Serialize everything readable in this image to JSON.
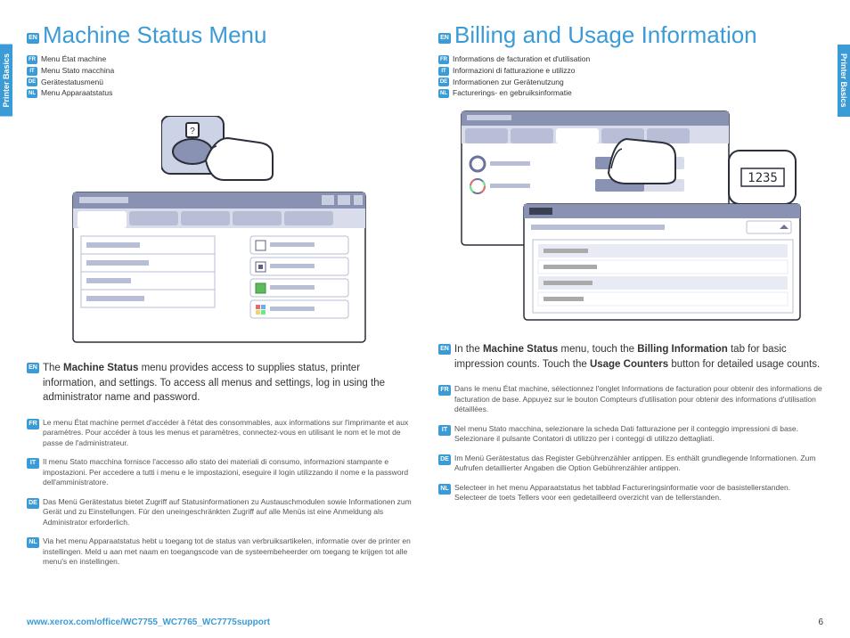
{
  "sideTab": "Printer Basics",
  "left": {
    "titleBadge": "EN",
    "title": "Machine Status Menu",
    "langList": [
      {
        "code": "FR",
        "text": "Menu État machine"
      },
      {
        "code": "IT",
        "text": "Menu Stato macchina"
      },
      {
        "code": "DE",
        "text": "Gerätestatusmenü"
      },
      {
        "code": "NL",
        "text": "Menu Apparaatstatus"
      }
    ],
    "mainBadge": "EN",
    "mainPre": "The ",
    "mainBold": "Machine Status",
    "mainPost": " menu provides access to supplies status, printer information, and settings. To access all menus and settings, log in using the administrator name and password.",
    "translations": [
      {
        "code": "FR",
        "text": "Le menu État machine permet d'accéder à l'état des consommables, aux informations sur l'imprimante et aux paramètres. Pour accéder à tous les menus et paramètres, connectez-vous en utilisant le nom et le mot de passe de l'administrateur."
      },
      {
        "code": "IT",
        "text": "Il menu Stato macchina fornisce l'accesso allo stato dei materiali di consumo, informazioni stampante e impostazioni. Per accedere a tutti i menu e le impostazioni, eseguire il login utilizzando il nome e la password dell'amministratore."
      },
      {
        "code": "DE",
        "text": "Das Menü Gerätestatus bietet Zugriff auf Statusinformationen zu Austauschmodulen sowie Informationen zum Gerät und zu Einstellungen. Für den uneingeschränkten Zugriff auf alle Menüs ist eine Anmeldung als Administrator erforderlich."
      },
      {
        "code": "NL",
        "text": "Via het menu Apparaatstatus hebt u toegang tot de status van verbruiksartikelen, informatie over de printer en instellingen. Meld u aan met naam en toegangscode van de systeembeheerder om toegang te krijgen tot alle menu's en instellingen."
      }
    ]
  },
  "right": {
    "titleBadge": "EN",
    "title": "Billing and Usage Information",
    "langList": [
      {
        "code": "FR",
        "text": "Informations de facturation et d'utilisation"
      },
      {
        "code": "IT",
        "text": "Informazioni di fatturazione e utilizzo"
      },
      {
        "code": "DE",
        "text": "Informationen zur Gerätenutzung"
      },
      {
        "code": "NL",
        "text": "Facturerings- en gebruiksinformatie"
      }
    ],
    "mainBadge": "EN",
    "mainText1": "In the ",
    "mainBold1": "Machine Status",
    "mainText2": " menu, touch the ",
    "mainBold2": "Billing Information",
    "mainText3": " tab for basic impression counts. Touch the ",
    "mainBold3": "Usage Counters",
    "mainText4": " button for detailed usage counts.",
    "translations": [
      {
        "code": "FR",
        "text": "Dans le menu État machine, sélectionnez l'onglet Informations de facturation pour obtenir des informations de facturation de base. Appuyez sur le bouton Compteurs d'utilisation pour obtenir des informations d'utilisation détaillées."
      },
      {
        "code": "IT",
        "text": "Nel menu Stato macchina, selezionare la scheda Dati fatturazione per il conteggio impressioni di base. Selezionare il pulsante Contatori di utilizzo per i conteggi di utilizzo dettagliati."
      },
      {
        "code": "DE",
        "text": "Im Menü Gerätestatus das Register Gebührenzähler antippen. Es enthält grundlegende Informationen. Zum Aufrufen detaillierter Angaben die Option Gebührenzähler antippen."
      },
      {
        "code": "NL",
        "text": "Selecteer in het menu Apparaatstatus het tabblad Factureringsinformatie voor de basistellerstanden. Selecteer de toets Tellers voor een gedetailleerd overzicht van de tellerstanden."
      }
    ]
  },
  "footer": {
    "link": "www.xerox.com/office/WC7755_WC7765_WC7775support",
    "page": "6"
  },
  "counterDisplay": "1235"
}
